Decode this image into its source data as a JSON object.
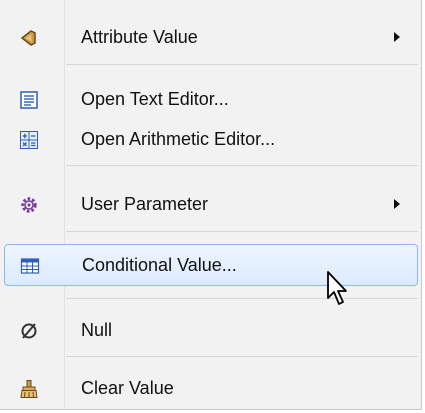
{
  "menu": {
    "items": [
      {
        "label": "Attribute Value",
        "icon": "attribute-value-icon",
        "submenu": true
      },
      {
        "label": "Open Text Editor...",
        "icon": "text-editor-icon",
        "submenu": false
      },
      {
        "label": "Open Arithmetic Editor...",
        "icon": "arithmetic-editor-icon",
        "submenu": false
      },
      {
        "label": "User Parameter",
        "icon": "user-parameter-icon",
        "submenu": true
      },
      {
        "label": "Conditional Value...",
        "icon": "conditional-value-icon",
        "submenu": false,
        "highlighted": true
      },
      {
        "label": "Null",
        "icon": "null-icon",
        "submenu": false
      },
      {
        "label": "Clear Value",
        "icon": "clear-value-icon",
        "submenu": false
      }
    ]
  },
  "colors": {
    "menu_background": "#f2f2f2",
    "highlight_border": "#8fb8ea",
    "highlight_fill": "#dcebfc",
    "icon_blue": "#2f5fb3",
    "icon_purple": "#7a3fa0",
    "icon_tan": "#a4762e"
  }
}
